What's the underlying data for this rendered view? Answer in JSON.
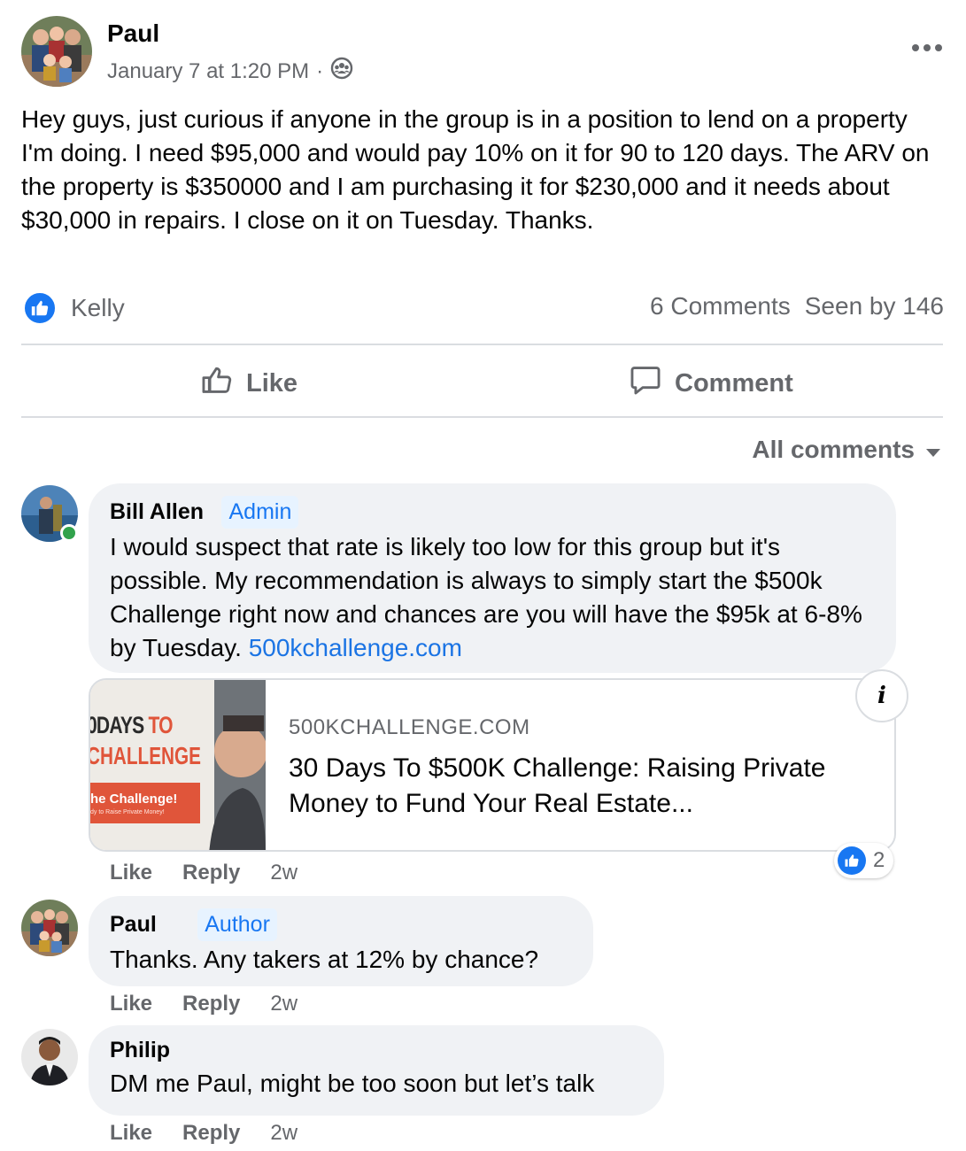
{
  "post": {
    "author": "Paul",
    "timestamp": "January 7 at 1:20 PM",
    "separator": "·",
    "audience_icon": "group-icon",
    "body": "Hey guys, just curious if anyone in the group is in a position to lend on a property I'm doing. I need $95,000 and would pay 10% on it for 90 to 120 days. The ARV on the property is $350000 and I am purchasing it for $230,000 and it needs about $30,000 in repairs. I close on it on Tuesday. Thanks.",
    "reactor": "Kelly",
    "comments_count": "6 Comments",
    "seen_by": "Seen by 146"
  },
  "actions": {
    "like": "Like",
    "comment": "Comment"
  },
  "sort": {
    "label": "All comments"
  },
  "comments": [
    {
      "name": "Bill Allen",
      "badge": "Admin",
      "text": "I would suspect that rate is likely too low for this group but it's possible. My recommendation is always to simply start the $500k Challenge right now and chances are you will have the $95k at 6-8% by Tuesday. ",
      "link": "500kchallenge.com",
      "like": "Like",
      "reply": "Reply",
      "age": "2w",
      "reactions": "2",
      "card": {
        "domain": "500KCHALLENGE.COM",
        "title": "30 Days To $500K Challenge: Raising Private Money to Fund Your Real Estate...",
        "thumb_line1a": "0DAYS",
        "thumb_line1b": "TO",
        "thumb_line2": "CHALLENGE",
        "thumb_banner": "he Challenge!",
        "thumb_sub": "dy to Raise Private Money!"
      }
    },
    {
      "name": "Paul",
      "badge": "Author",
      "text": "Thanks. Any takers at 12% by chance?",
      "like": "Like",
      "reply": "Reply",
      "age": "2w"
    },
    {
      "name": "Philip",
      "text": "DM me Paul, might be too soon but let’s talk",
      "like": "Like",
      "reply": "Reply",
      "age": "2w"
    }
  ],
  "colors": {
    "accent": "#1877f2",
    "link": "#1b74e4",
    "muted": "#65676b",
    "bubble": "#f0f2f5",
    "online": "#31a24c",
    "card_orange": "#e0553a"
  }
}
